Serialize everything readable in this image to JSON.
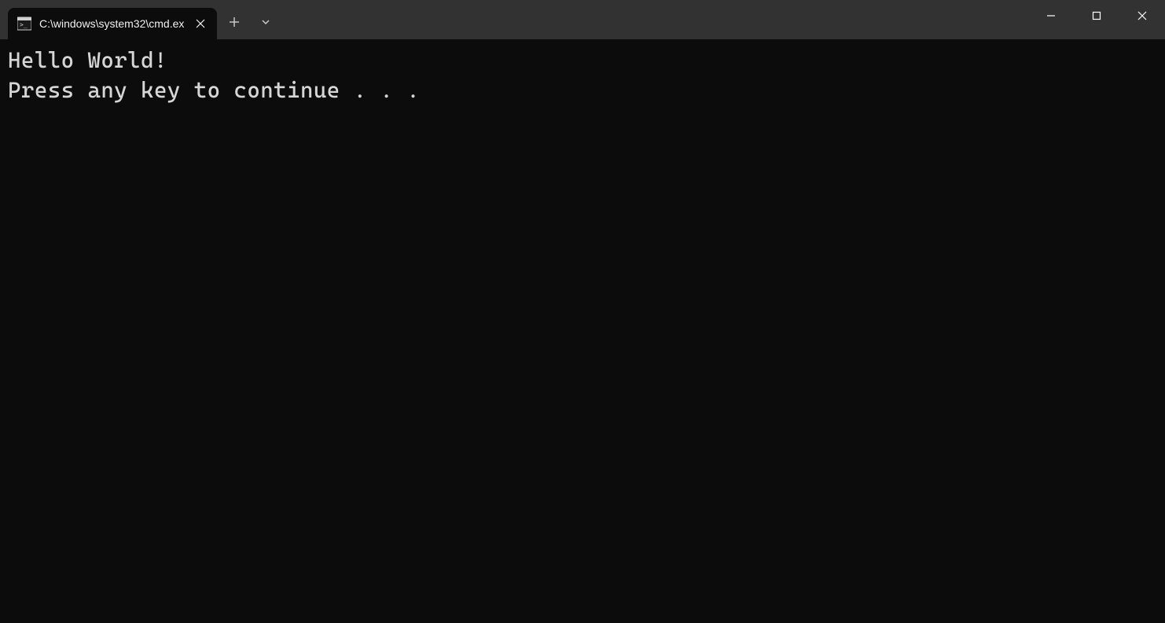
{
  "tab": {
    "title": "C:\\windows\\system32\\cmd.ex",
    "icon": "cmd-icon"
  },
  "newTab": {
    "icon": "plus-icon"
  },
  "dropdown": {
    "icon": "chevron-down-icon"
  },
  "windowControls": {
    "minimize": "minimize-icon",
    "maximize": "maximize-icon",
    "close": "close-icon"
  },
  "console": {
    "lines": [
      "Hello World!",
      "Press any key to continue . . ."
    ]
  }
}
